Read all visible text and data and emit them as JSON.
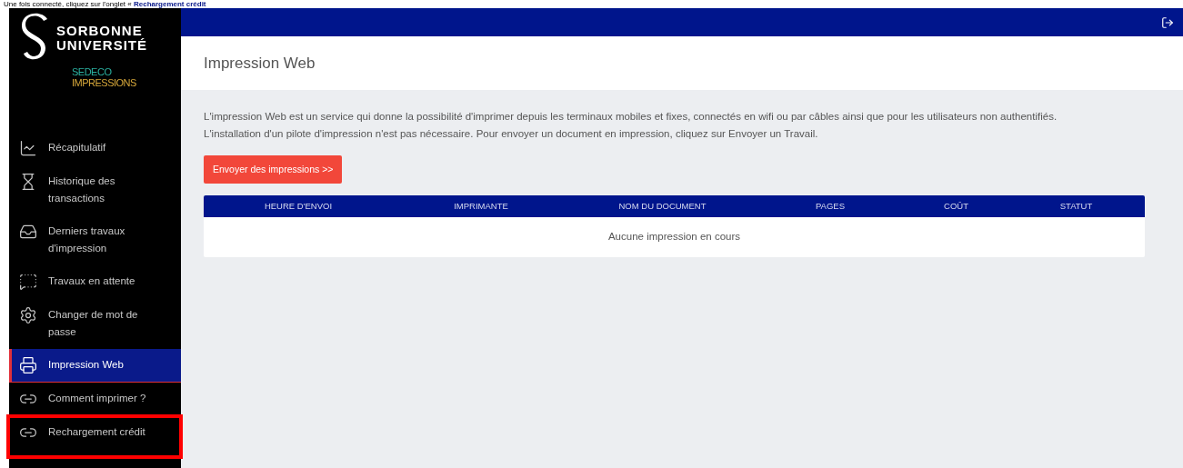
{
  "caption": {
    "text": "Une fois connecté, cliquez sur l'onglet « ",
    "highlight": "Rechargement crédit"
  },
  "logo": {
    "line_1": "SORBONNE",
    "line_2": "UNIVERSITÉ",
    "product_1": "SEDECO",
    "product_2": "IMPRESSIONS"
  },
  "sidebar": {
    "items": [
      {
        "label": "Récapitulatif",
        "selected": false,
        "outlined": false
      },
      {
        "label": "Historique des transactions",
        "selected": false,
        "outlined": false
      },
      {
        "label": "Derniers travaux d'impression",
        "selected": false,
        "outlined": false
      },
      {
        "label": "Travaux en attente",
        "selected": false,
        "outlined": false
      },
      {
        "label": "Changer de mot de passe",
        "selected": false,
        "outlined": false
      },
      {
        "label": "Impression Web",
        "selected": true,
        "outlined": false
      },
      {
        "label": "Comment imprimer ?",
        "selected": false,
        "outlined": false
      },
      {
        "label": "Rechargement crédit",
        "selected": false,
        "outlined": true
      }
    ]
  },
  "page": {
    "title": "Impression Web",
    "intro": [
      "L'impression Web est un service qui donne la possibilité d'imprimer depuis les terminaux mobiles et fixes, connectés en wifi ou par câbles ainsi que pour les utilisateurs non authentifiés.",
      "L'installation d'un pilote d'impression n'est pas nécessaire. Pour envoyer un document en impression, cliquez sur Envoyer un Travail."
    ],
    "send_button": "Envoyer des impressions >>",
    "table": {
      "columns": [
        "HEURE D'ENVOI",
        "IMPRIMANTE",
        "NOM DU DOCUMENT",
        "PAGES",
        "COÛT",
        "STATUT"
      ],
      "empty_message": "Aucune impression en cours"
    }
  }
}
